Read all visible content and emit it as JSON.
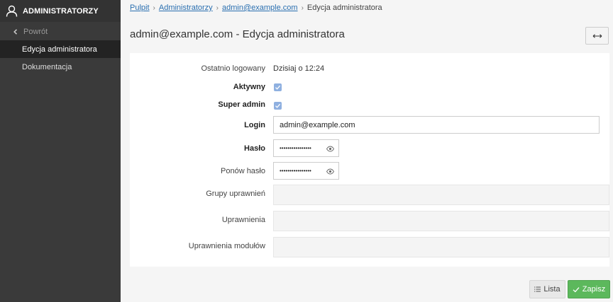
{
  "sidebar": {
    "title": "ADMINISTRATORZY",
    "back_label": "Powrót",
    "items": [
      {
        "label": "Edycja administratora",
        "active": true
      },
      {
        "label": "Dokumentacja",
        "active": false
      }
    ]
  },
  "breadcrumb": {
    "items": [
      "Pulpit",
      "Administratorzy",
      "admin@example.com"
    ],
    "current": "Edycja administratora",
    "separator": "›"
  },
  "page": {
    "title": "admin@example.com - Edycja administratora",
    "toggle_icon": "expand-horizontal-icon"
  },
  "form": {
    "last_login_label": "Ostatnio logowany",
    "last_login_value": "Dzisiaj o 12:24",
    "active_label": "Aktywny",
    "active_checked": true,
    "superadmin_label": "Super admin",
    "superadmin_checked": true,
    "login_label": "Login",
    "login_value": "admin@example.com",
    "password_label": "Hasło",
    "password_mask": "••••••••••••••••",
    "repeat_password_label": "Ponów hasło",
    "repeat_password_mask": "••••••••••••••••",
    "groups_label": "Grupy uprawnień",
    "permissions_label": "Uprawnienia",
    "module_permissions_label": "Uprawnienia modułów"
  },
  "actions": {
    "list_label": "Lista",
    "save_label": "Zapisz"
  },
  "colors": {
    "sidebar_bg": "#3a3a3a",
    "sidebar_active": "#232323",
    "link": "#2a6fb0",
    "checkbox": "#8fb0e0",
    "save": "#5cb85c"
  }
}
